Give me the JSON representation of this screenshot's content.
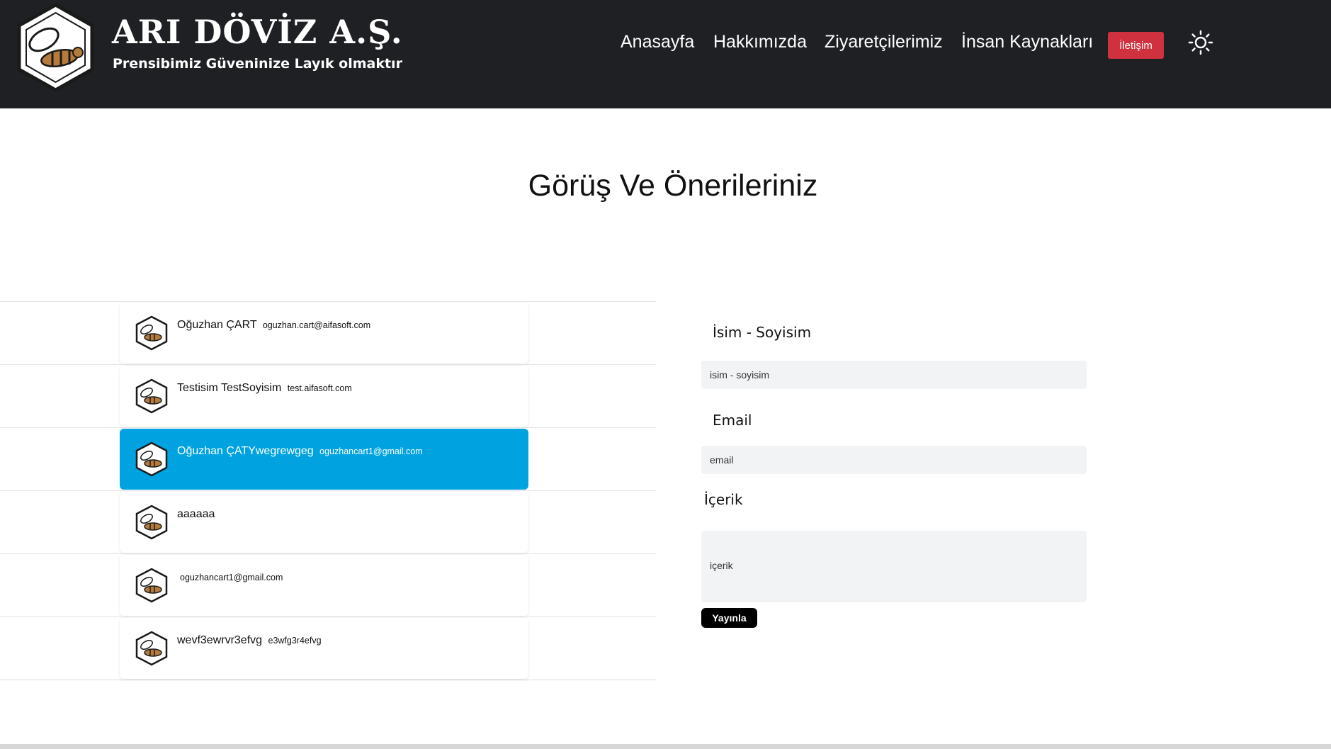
{
  "header": {
    "brand_title": "ARI DÖVİZ A.Ş.",
    "brand_subtitle": "Prensibimiz Güveninize Layık olmaktır",
    "nav": [
      "Anasayfa",
      "Hakkımızda",
      "Ziyaretçilerimiz",
      "İnsan Kaynakları"
    ],
    "contact_button": "İletişim",
    "theme_icon": "sun-icon"
  },
  "page_title": "Görüş Ve Önerileriniz",
  "comments": [
    {
      "name": "Oğuzhan ÇART",
      "email": "oguzhan.cart@aifasoft.com"
    },
    {
      "name": "Testisim TestSoyisim",
      "email": "test.aifasoft.com"
    },
    {
      "name": "Oğuzhan ÇATYwegrewgeg",
      "email": "oguzhancart1@gmail.com"
    },
    {
      "name": "aaaaaa",
      "email": ""
    },
    {
      "name": "",
      "email": "oguzhancart1@gmail.com"
    },
    {
      "name": "wevf3ewrvr3efvg",
      "email": "e3wfg3r4efvg"
    }
  ],
  "form": {
    "name_label": "İsim - Soyisim",
    "name_placeholder": "isim - soyisim",
    "email_label": "Email",
    "email_placeholder": "email",
    "content_label": "İçerik",
    "content_placeholder": "içerik",
    "submit_label": "Yayınla"
  },
  "colors": {
    "header_bg": "#1f2024",
    "contact_button": "#d0313f",
    "active_card": "#00a3e0",
    "input_bg": "#f2f3f5"
  }
}
